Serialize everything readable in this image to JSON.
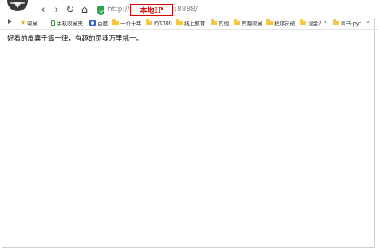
{
  "toolbar": {
    "back_icon": "‹",
    "forward_icon": "›",
    "reload_icon": "↻",
    "home_icon": "⌂"
  },
  "address": {
    "prefix": "http://",
    "host_label": "本地IP",
    "suffix": ":8888/"
  },
  "bookmarks": {
    "items": [
      {
        "label": "收藏",
        "icon": "star"
      },
      {
        "label": "手机收藏夹",
        "icon": "phone"
      },
      {
        "label": "百度",
        "icon": "baidu"
      },
      {
        "label": "一介十年",
        "icon": "folder"
      },
      {
        "label": "Python",
        "icon": "folder"
      },
      {
        "label": "线上教育",
        "icon": "folder"
      },
      {
        "label": "其他",
        "icon": "folder"
      },
      {
        "label": "有趣收藏",
        "icon": "folder"
      },
      {
        "label": "程序员破",
        "icon": "folder"
      },
      {
        "label": "现金？？",
        "icon": "folder"
      },
      {
        "label": "简书-pyt",
        "icon": "folder"
      }
    ],
    "more": "»"
  },
  "page": {
    "text": "好看的皮囊千篇一律，有趣的灵魂万里挑一。"
  }
}
